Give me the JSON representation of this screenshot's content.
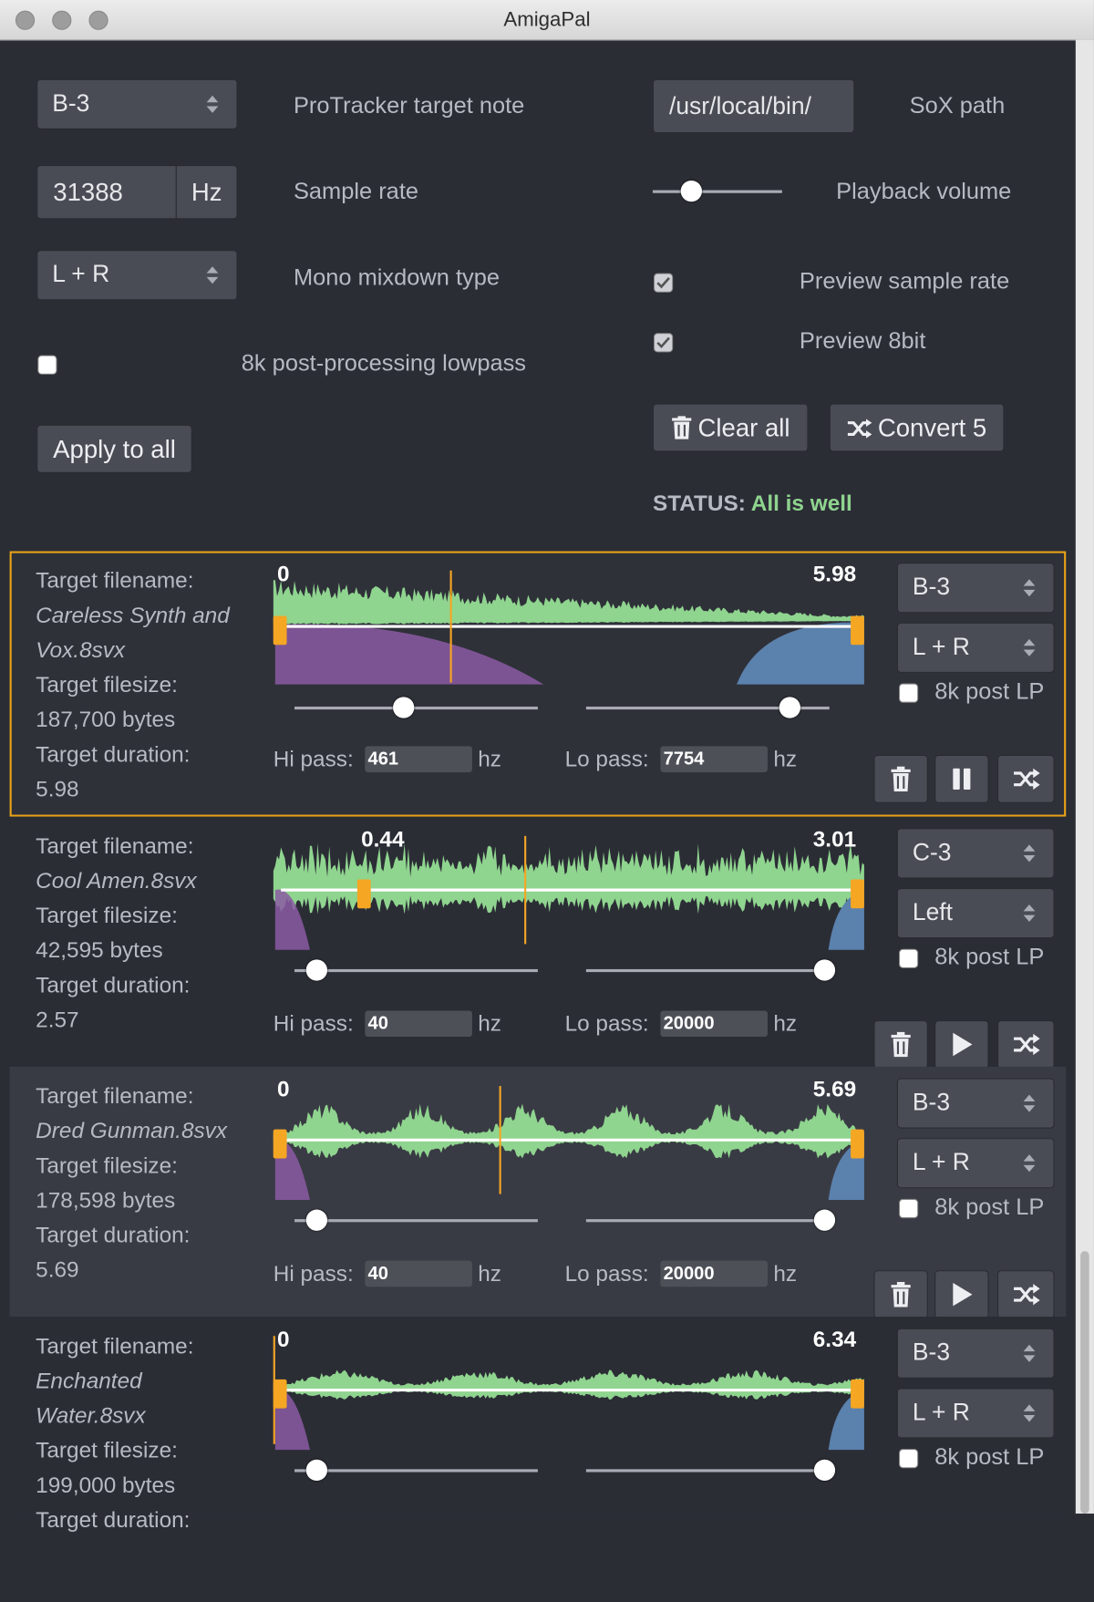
{
  "window": {
    "title": "AmigaPal"
  },
  "global": {
    "note": "B-3",
    "note_label": "ProTracker target note",
    "sox_path": "/usr/local/bin/",
    "sox_label": "SoX path",
    "sample_rate": "31388",
    "sample_rate_unit": "Hz",
    "sample_rate_label": "Sample rate",
    "volume_label": "Playback volume",
    "volume_level": 0.3,
    "mixdown": "L + R",
    "mixdown_label": "Mono mixdown type",
    "preview_rate_label": "Preview sample rate",
    "preview_rate_checked": true,
    "preview_8bit_label": "Preview 8bit",
    "preview_8bit_checked": true,
    "lowpass_label": "8k post-processing lowpass",
    "lowpass_checked": false,
    "apply_all": "Apply to all",
    "clear_all": "Clear all",
    "convert": "Convert 5",
    "status_label": "STATUS:",
    "status_value": "All is well",
    "status_color": "#8fd48f"
  },
  "labels": {
    "target_filename": "Target filename:",
    "target_filesize": "Target filesize:",
    "target_duration": "Target duration:",
    "hi_pass": "Hi pass:",
    "lo_pass": "Lo pass:",
    "hz": "hz",
    "post_lp": "8k post LP"
  },
  "colors": {
    "wave": "#8fd48f",
    "hipass_region": "#8b5ba3",
    "lopass_region": "#5b81ad",
    "marker": "#f5a623",
    "selected_border": "#e8a317"
  },
  "samples": [
    {
      "filename_line1": "Careless Synth and",
      "filename_line2": "Vox.8svx",
      "filesize": "187,700 bytes",
      "duration": "5.98",
      "start": "0",
      "end": "5.98",
      "note": "B-3",
      "mix": "L + R",
      "post_lp": false,
      "hi_pass": "461",
      "lo_pass": "7754",
      "state": "playing",
      "selected": true
    },
    {
      "filename_line1": "Cool Amen.8svx",
      "filename_line2": "",
      "filesize": "42,595 bytes",
      "duration": "2.57",
      "start": "0.44",
      "end": "3.01",
      "note": "C-3",
      "mix": "Left",
      "post_lp": false,
      "hi_pass": "40",
      "lo_pass": "20000",
      "state": "stopped",
      "selected": false
    },
    {
      "filename_line1": "Dred Gunman.8svx",
      "filename_line2": "",
      "filesize": "178,598 bytes",
      "duration": "5.69",
      "start": "0",
      "end": "5.69",
      "note": "B-3",
      "mix": "L + R",
      "post_lp": false,
      "hi_pass": "40",
      "lo_pass": "20000",
      "state": "stopped",
      "selected": false
    },
    {
      "filename_line1": "Enchanted",
      "filename_line2": "Water.8svx",
      "filesize": "199,000 bytes",
      "duration": "",
      "start": "0",
      "end": "6.34",
      "note": "B-3",
      "mix": "L + R",
      "post_lp": false,
      "hi_pass": "",
      "lo_pass": "",
      "state": "stopped",
      "selected": false
    }
  ]
}
